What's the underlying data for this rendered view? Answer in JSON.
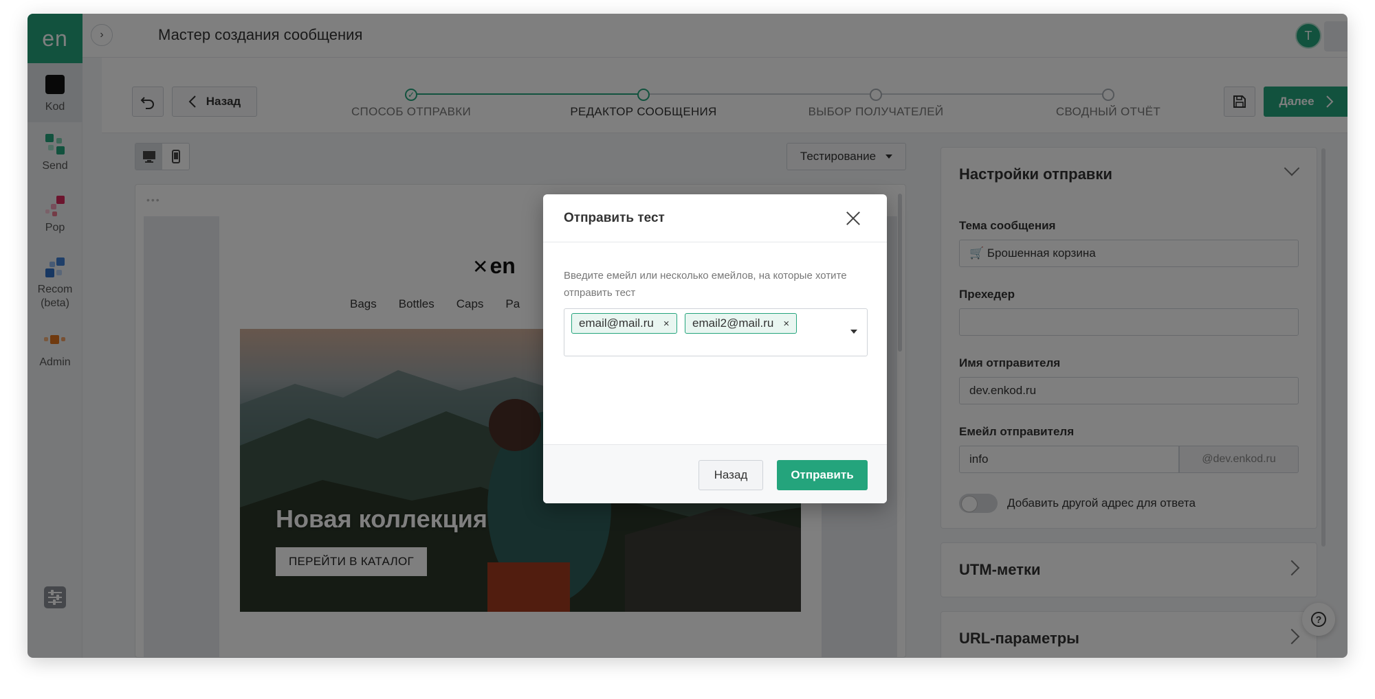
{
  "sidebar": {
    "logo": "en",
    "items": [
      {
        "label": "Kod"
      },
      {
        "label": "Send"
      },
      {
        "label": "Pop"
      },
      {
        "label": "Recom\n(beta)"
      },
      {
        "label": "Admin"
      }
    ]
  },
  "header": {
    "title": "Мастер создания сообщения",
    "avatar_letter": "Т"
  },
  "toolbar": {
    "back_label": "Назад",
    "next_label": "Далее"
  },
  "steps": [
    {
      "label": "СПОСОБ ОТПРАВКИ",
      "state": "done"
    },
    {
      "label": "РЕДАКТОР СООБЩЕНИЯ",
      "state": "current"
    },
    {
      "label": "ВЫБОР ПОЛУЧАТЕЛЕЙ",
      "state": "pending"
    },
    {
      "label": "СВОДНЫЙ ОТЧЁТ",
      "state": "pending"
    }
  ],
  "editor": {
    "testing_label": "Тестирование",
    "preview_dots": "•••",
    "email": {
      "logo_text": "en",
      "nav": [
        "Bags",
        "Bottles",
        "Caps",
        "Pa"
      ],
      "hero_title": "Новая коллекция",
      "hero_button": "ПЕРЕЙТИ В КАТАЛОГ"
    }
  },
  "settings": {
    "title": "Настройки отправки",
    "subject_label": "Тема сообщения",
    "subject_value": "🛒 Брошенная корзина",
    "preheader_label": "Прехедер",
    "preheader_value": "",
    "sender_name_label": "Имя отправителя",
    "sender_name_value": "dev.enkod.ru",
    "sender_email_label": "Емейл отправителя",
    "sender_email_value": "info",
    "sender_email_domain": "@dev.enkod.ru",
    "reply_toggle_label": "Добавить другой адрес для ответа"
  },
  "utm": {
    "title": "UTM-метки"
  },
  "url_params": {
    "title": "URL-параметры"
  },
  "modal": {
    "title": "Отправить тест",
    "description": "Введите емейл или несколько емейлов, на которые хотите отправить тест",
    "recipients": [
      "email@mail.ru",
      "email2@mail.ru"
    ],
    "tag_remove": "×",
    "back_label": "Назад",
    "send_label": "Отправить"
  },
  "colors": {
    "accent": "#24a47c",
    "overlay": "rgba(0,0,0,0.5)"
  },
  "icons": {
    "undo": "undo-icon",
    "save": "save-icon",
    "help": "help-icon"
  }
}
